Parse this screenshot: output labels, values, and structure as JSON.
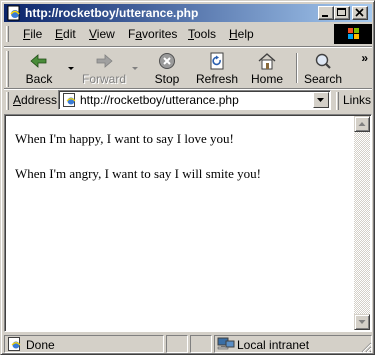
{
  "window": {
    "title": "http://rocketboy/utterance.php",
    "colors": {
      "titlebar_start": "#0a246a",
      "titlebar_end": "#a6caf0",
      "chrome": "#d4d0c8"
    }
  },
  "menu": {
    "file": {
      "accel": "F",
      "rest": "ile"
    },
    "edit": {
      "accel": "E",
      "rest": "dit"
    },
    "view": {
      "accel": "V",
      "rest": "iew"
    },
    "favorites": {
      "pre": "F",
      "accel": "a",
      "rest": "vorites"
    },
    "tools": {
      "accel": "T",
      "rest": "ools"
    },
    "help": {
      "accel": "H",
      "rest": "elp"
    }
  },
  "toolbar": {
    "back": {
      "label": "Back",
      "icon": "back-arrow-icon"
    },
    "forward": {
      "label": "Forward",
      "icon": "forward-arrow-icon",
      "disabled": true
    },
    "stop": {
      "label": "Stop",
      "icon": "stop-icon"
    },
    "refresh": {
      "label": "Refresh",
      "icon": "refresh-icon"
    },
    "home": {
      "label": "Home",
      "icon": "home-icon"
    },
    "search": {
      "label": "Search",
      "icon": "search-icon"
    },
    "more": "»"
  },
  "address": {
    "label_accel": "A",
    "label_rest": "ddress",
    "url": "http://rocketboy/utterance.php",
    "links": "Links"
  },
  "page": {
    "lines": [
      "When I'm happy, I want to say I love you!",
      "When I'm angry, I want to say I will smite you!"
    ]
  },
  "status": {
    "text": "Done",
    "zone": "Local intranet"
  }
}
